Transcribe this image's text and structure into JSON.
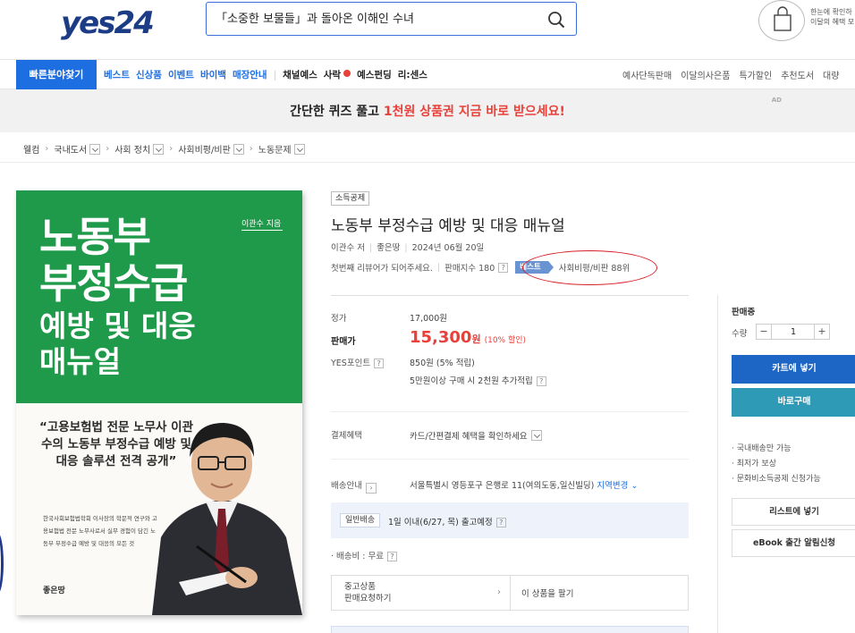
{
  "header": {
    "logo": "yes24",
    "search_value": "「소중한 보물들」과 돌아온 이해인 수녀",
    "cart_text_1": "한눈에 확인하",
    "cart_text_2": "이달의 혜택 모"
  },
  "nav": {
    "quick": "빠른분야찾기",
    "left_blue": [
      "베스트",
      "신상품",
      "이벤트",
      "바이백",
      "매장안내"
    ],
    "left_dark": [
      "채널예스",
      "사락",
      "예스펀딩",
      "리:센스"
    ],
    "right": [
      "예사단독판매",
      "이달의사은품",
      "특가할인",
      "추천도서",
      "대량"
    ]
  },
  "banner": {
    "pre": "간단한 퀴즈 풀고 ",
    "highlight": "1천원 상품권 지금 바로 받으세요!",
    "ad": "AD"
  },
  "breadcrumb": [
    "웰컴",
    "국내도서",
    "사회 정치",
    "사회비평/비판",
    "노동문제"
  ],
  "cover": {
    "author": "이관수 지음",
    "title_1": "노동부",
    "title_2": "부정수급",
    "title_3": "예방 및 대응",
    "title_4": "매뉴얼",
    "quote": "“고용보험법 전문 노무사 이관수의 노동부 부정수급 예방 및 대응 솔루션 전격 공개”",
    "desc": "한국사회보험법학회 이사장의 학문적 연구와 고용보험법 전문 노무사로서 실무 경험이 담긴 노동부 부정수급 예방 및 대응의 모든 것",
    "publisher": "좋은땅"
  },
  "product": {
    "tax_badge": "소득공제",
    "title": "노동부 부정수급 예방 및 대응 매뉴얼",
    "author": "이관수 저",
    "publisher": "좋은땅",
    "date": "2024년 06월 20일",
    "review": "첫번째 리뷰어가 되어주세요.",
    "sales_index": "판매지수 180",
    "best_badge": "베스트",
    "best_rank": "사회비평/비판 88위",
    "list_price_label": "정가",
    "list_price": "17,000원",
    "sale_label": "판매가",
    "sale_price": "15,300",
    "sale_unit": "원",
    "discount": "(10% 할인)",
    "point_label": "YES포인트",
    "point_value": "850원 (5% 적립)",
    "point_extra": "5만원이상 구매 시 2천원 추가적립",
    "pay_label": "결제혜택",
    "pay_value": "카드/간편결제 혜택을 확인하세요",
    "ship_label": "배송안내",
    "ship_addr": "서울특별시 영등포구 은행로 11(여의도동,일신빌딩)",
    "region_change": "지역변경",
    "delivery_tag": "일반배송",
    "delivery_text": "1일 이내(6/27, 목) 출고예정",
    "shipping_fee": "· 배송비 : 무료",
    "used_line1": "중고상품",
    "used_line2": "판매요청하기",
    "sell_item": "이 상품을 팔기"
  },
  "panel": {
    "status": "판매중",
    "qty_label": "수량",
    "qty_value": "1",
    "cart_button": "카트에 넣기",
    "buy_button": "바로구매",
    "note1": "· 국내배송만 가능",
    "note2": "· 최저가 보상",
    "note3": "· 문화비소득공제 신청가능",
    "list_button": "리스트에 넣기",
    "alert_button": "eBook 출간 알림신청"
  },
  "colors": {
    "brand_blue": "#1d6ee0",
    "sale_red": "#e8413a",
    "cover_green": "#1e9a4a"
  }
}
